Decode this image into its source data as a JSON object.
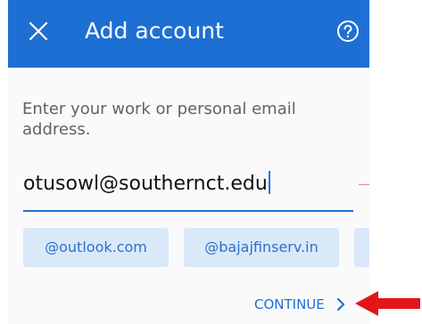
{
  "app_bar": {
    "title": "Add account",
    "close_icon": "close-icon",
    "help_icon": "help-icon",
    "background": "#1e6fd3"
  },
  "form": {
    "prompt": "Enter your work or personal email address.",
    "email_value": "otusowl@southernct.edu",
    "domain_suggestions": [
      "@outlook.com",
      "@bajajfinserv.in"
    ]
  },
  "footer": {
    "continue_label": "CONTINUE",
    "continue_icon": "chevron-right-icon"
  },
  "annotation": {
    "arrow_icon": "red-arrow-icon",
    "arrow_color": "#e4141b"
  }
}
